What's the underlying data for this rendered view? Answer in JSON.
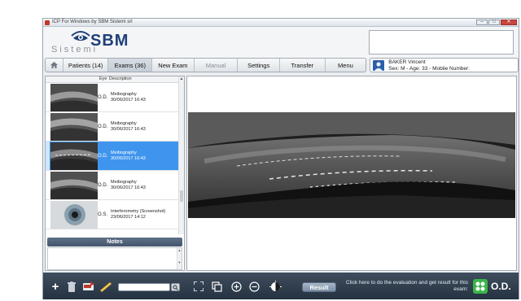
{
  "window": {
    "title": "ICP For Windows by SBM Sistemi srl",
    "controls": [
      "minimize",
      "maximize",
      "close"
    ]
  },
  "logo": {
    "brand": "SBM",
    "subtitle": "Sistemi",
    "icon": "eye-logo-icon"
  },
  "nav": {
    "home_icon": "home-icon",
    "tabs": [
      {
        "label": "Patients (14)",
        "state": "normal"
      },
      {
        "label": "Exams (36)",
        "state": "selected"
      },
      {
        "label": "New Exam",
        "state": "normal"
      },
      {
        "label": "Manual",
        "state": "disabled"
      },
      {
        "label": "Settings",
        "state": "normal"
      },
      {
        "label": "Transfer",
        "state": "normal"
      },
      {
        "label": "Menu",
        "state": "normal"
      }
    ]
  },
  "patient": {
    "name": "BAKER Vincent",
    "info": "Sex: M - Age: 33 - Mobile Number:"
  },
  "exam_list": {
    "columns": {
      "eye": "Eye",
      "description": "Description"
    },
    "items": [
      {
        "eye": "O.D.",
        "type": "Meibography",
        "date": "30/06/2017 16:43",
        "selected": false
      },
      {
        "eye": "O.D.",
        "type": "Meibography",
        "date": "30/06/2017 16:43",
        "selected": false
      },
      {
        "eye": "O.D.",
        "type": "Meibography",
        "date": "30/06/2017 16:43",
        "selected": true
      },
      {
        "eye": "O.D.",
        "type": "Meibography",
        "date": "30/06/2017 16:43",
        "selected": false
      },
      {
        "eye": "O.S.",
        "type": "Interferometry (Screenshot)",
        "date": "23/06/2017 14:12",
        "selected": false
      }
    ]
  },
  "notes": {
    "title": "Notes",
    "value": ""
  },
  "bottom_toolbar": {
    "left_icons": [
      "add-icon",
      "trash-icon",
      "export-icon",
      "pencil-icon"
    ],
    "search_placeholder": "",
    "viewer_icons": [
      "fullscreen-icon",
      "copy-icon",
      "zoom-in-icon",
      "zoom-out-icon",
      "contrast-icon"
    ],
    "result_button": "Result",
    "hint": "Click here to do the evaluation and get result for this exam:",
    "eye": "O.D."
  },
  "colors": {
    "accent": "#3f95ee",
    "brand": "#1f3f78",
    "toolbar": "#2f3d4e",
    "result_green": "#3cb54a"
  }
}
